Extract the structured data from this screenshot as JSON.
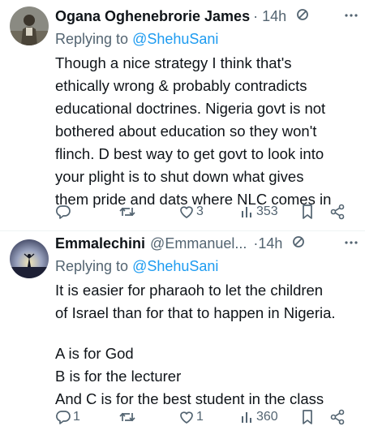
{
  "tweets": [
    {
      "display_name": "Ogana Oghenebrorie James",
      "handle": "",
      "time": "· 14h",
      "replying_prefix": "Replying to ",
      "replying_handle": "@ShehuSani",
      "lines": [
        "Though a nice strategy I think that's",
        "ethically wrong & probably contradicts",
        "educational doctrines. Nigeria govt is not",
        "bothered about education so they won't",
        "flinch. D best way to get govt to look into",
        "your plight is to shut down what gives",
        "them pride and dats where NLC comes in"
      ],
      "stats": {
        "replies": "",
        "retweets": "",
        "likes": "3",
        "views": "353"
      }
    },
    {
      "display_name": "Emmalechini",
      "handle": "@Emmanuel...",
      "time": "·14h",
      "replying_prefix": "Replying to ",
      "replying_handle": "@ShehuSani",
      "lines": [
        "It is easier for pharaoh to let the children",
        "of Israel than for that to happen in Nigeria.",
        "",
        "A is for God",
        "B is for the lecturer",
        "And C is for the best student in the class"
      ],
      "stats": {
        "replies": "1",
        "retweets": "",
        "likes": "1",
        "views": "360"
      }
    }
  ],
  "icons": {
    "reply": "reply-icon",
    "retweet": "retweet-icon",
    "like": "heart-icon",
    "views": "views-icon",
    "bookmark": "bookmark-icon",
    "share": "share-icon",
    "muted": "nosign-icon",
    "more": "more-icon"
  },
  "colors": {
    "text": "#0f1419",
    "secondary": "#536471",
    "link": "#1d9bf0",
    "divider": "#eff3f4"
  }
}
